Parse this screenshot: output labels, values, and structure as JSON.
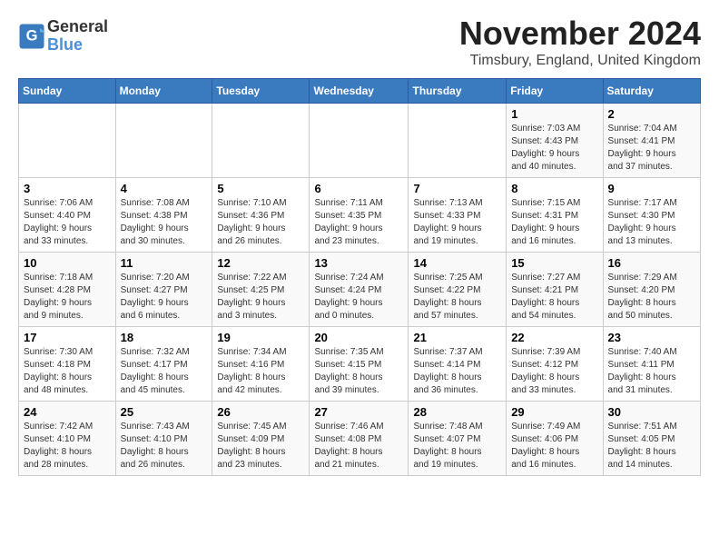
{
  "logo": {
    "line1": "General",
    "line2": "Blue"
  },
  "title": "November 2024",
  "location": "Timsbury, England, United Kingdom",
  "header": {
    "days": [
      "Sunday",
      "Monday",
      "Tuesday",
      "Wednesday",
      "Thursday",
      "Friday",
      "Saturday"
    ]
  },
  "weeks": [
    [
      {
        "day": "",
        "info": ""
      },
      {
        "day": "",
        "info": ""
      },
      {
        "day": "",
        "info": ""
      },
      {
        "day": "",
        "info": ""
      },
      {
        "day": "",
        "info": ""
      },
      {
        "day": "1",
        "info": "Sunrise: 7:03 AM\nSunset: 4:43 PM\nDaylight: 9 hours\nand 40 minutes."
      },
      {
        "day": "2",
        "info": "Sunrise: 7:04 AM\nSunset: 4:41 PM\nDaylight: 9 hours\nand 37 minutes."
      }
    ],
    [
      {
        "day": "3",
        "info": "Sunrise: 7:06 AM\nSunset: 4:40 PM\nDaylight: 9 hours\nand 33 minutes."
      },
      {
        "day": "4",
        "info": "Sunrise: 7:08 AM\nSunset: 4:38 PM\nDaylight: 9 hours\nand 30 minutes."
      },
      {
        "day": "5",
        "info": "Sunrise: 7:10 AM\nSunset: 4:36 PM\nDaylight: 9 hours\nand 26 minutes."
      },
      {
        "day": "6",
        "info": "Sunrise: 7:11 AM\nSunset: 4:35 PM\nDaylight: 9 hours\nand 23 minutes."
      },
      {
        "day": "7",
        "info": "Sunrise: 7:13 AM\nSunset: 4:33 PM\nDaylight: 9 hours\nand 19 minutes."
      },
      {
        "day": "8",
        "info": "Sunrise: 7:15 AM\nSunset: 4:31 PM\nDaylight: 9 hours\nand 16 minutes."
      },
      {
        "day": "9",
        "info": "Sunrise: 7:17 AM\nSunset: 4:30 PM\nDaylight: 9 hours\nand 13 minutes."
      }
    ],
    [
      {
        "day": "10",
        "info": "Sunrise: 7:18 AM\nSunset: 4:28 PM\nDaylight: 9 hours\nand 9 minutes."
      },
      {
        "day": "11",
        "info": "Sunrise: 7:20 AM\nSunset: 4:27 PM\nDaylight: 9 hours\nand 6 minutes."
      },
      {
        "day": "12",
        "info": "Sunrise: 7:22 AM\nSunset: 4:25 PM\nDaylight: 9 hours\nand 3 minutes."
      },
      {
        "day": "13",
        "info": "Sunrise: 7:24 AM\nSunset: 4:24 PM\nDaylight: 9 hours\nand 0 minutes."
      },
      {
        "day": "14",
        "info": "Sunrise: 7:25 AM\nSunset: 4:22 PM\nDaylight: 8 hours\nand 57 minutes."
      },
      {
        "day": "15",
        "info": "Sunrise: 7:27 AM\nSunset: 4:21 PM\nDaylight: 8 hours\nand 54 minutes."
      },
      {
        "day": "16",
        "info": "Sunrise: 7:29 AM\nSunset: 4:20 PM\nDaylight: 8 hours\nand 50 minutes."
      }
    ],
    [
      {
        "day": "17",
        "info": "Sunrise: 7:30 AM\nSunset: 4:18 PM\nDaylight: 8 hours\nand 48 minutes."
      },
      {
        "day": "18",
        "info": "Sunrise: 7:32 AM\nSunset: 4:17 PM\nDaylight: 8 hours\nand 45 minutes."
      },
      {
        "day": "19",
        "info": "Sunrise: 7:34 AM\nSunset: 4:16 PM\nDaylight: 8 hours\nand 42 minutes."
      },
      {
        "day": "20",
        "info": "Sunrise: 7:35 AM\nSunset: 4:15 PM\nDaylight: 8 hours\nand 39 minutes."
      },
      {
        "day": "21",
        "info": "Sunrise: 7:37 AM\nSunset: 4:14 PM\nDaylight: 8 hours\nand 36 minutes."
      },
      {
        "day": "22",
        "info": "Sunrise: 7:39 AM\nSunset: 4:12 PM\nDaylight: 8 hours\nand 33 minutes."
      },
      {
        "day": "23",
        "info": "Sunrise: 7:40 AM\nSunset: 4:11 PM\nDaylight: 8 hours\nand 31 minutes."
      }
    ],
    [
      {
        "day": "24",
        "info": "Sunrise: 7:42 AM\nSunset: 4:10 PM\nDaylight: 8 hours\nand 28 minutes."
      },
      {
        "day": "25",
        "info": "Sunrise: 7:43 AM\nSunset: 4:10 PM\nDaylight: 8 hours\nand 26 minutes."
      },
      {
        "day": "26",
        "info": "Sunrise: 7:45 AM\nSunset: 4:09 PM\nDaylight: 8 hours\nand 23 minutes."
      },
      {
        "day": "27",
        "info": "Sunrise: 7:46 AM\nSunset: 4:08 PM\nDaylight: 8 hours\nand 21 minutes."
      },
      {
        "day": "28",
        "info": "Sunrise: 7:48 AM\nSunset: 4:07 PM\nDaylight: 8 hours\nand 19 minutes."
      },
      {
        "day": "29",
        "info": "Sunrise: 7:49 AM\nSunset: 4:06 PM\nDaylight: 8 hours\nand 16 minutes."
      },
      {
        "day": "30",
        "info": "Sunrise: 7:51 AM\nSunset: 4:05 PM\nDaylight: 8 hours\nand 14 minutes."
      }
    ]
  ]
}
